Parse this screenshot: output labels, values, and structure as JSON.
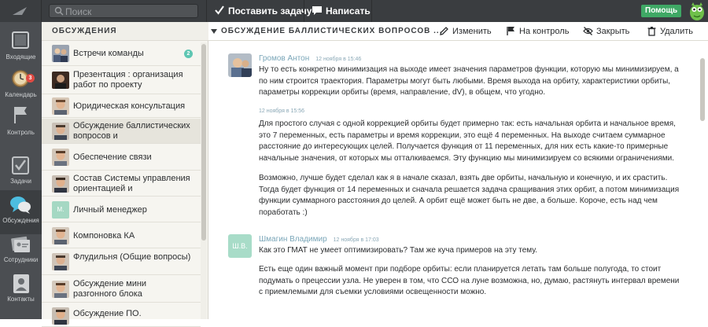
{
  "topbar": {
    "search_placeholder": "Поиск",
    "new_task_label": "Поставить задачу",
    "write_label": "Написать",
    "help_label": "Помощь"
  },
  "leftnav": {
    "items": [
      {
        "label": "Входящие",
        "icon": "inbox-icon"
      },
      {
        "label": "Календарь",
        "icon": "clock-icon",
        "badge": "3"
      },
      {
        "label": "Контроль",
        "icon": "flag-icon"
      },
      {
        "label": "Задачи",
        "icon": "checkbox-icon"
      },
      {
        "label": "Обсуждения",
        "icon": "chat-bubbles-icon",
        "active": true
      },
      {
        "label": "Сотрудники",
        "icon": "contacts-cards-icon"
      },
      {
        "label": "Контакты",
        "icon": "person-icon"
      }
    ]
  },
  "list": {
    "header": "ОБСУЖДЕНИЯ",
    "items": [
      {
        "title": "Встречи команды",
        "count": "2"
      },
      {
        "title": "Презентация : организация работ по проекту"
      },
      {
        "title": "Юридическая консультация"
      },
      {
        "title": "Обсуждение баллистических вопросов и",
        "active": true
      },
      {
        "title": "Обеспечение связи"
      },
      {
        "title": "Состав Системы управления ориентацией и"
      },
      {
        "title": "Личный менеджер",
        "initials": "М."
      },
      {
        "title": "Компоновка КА"
      },
      {
        "title": "Флудильня (Общие вопросы)"
      },
      {
        "title": "Обсуждение мини разгонного блока"
      },
      {
        "title": "Обсуждение ПО."
      }
    ]
  },
  "main": {
    "title": "ОБСУЖДЕНИЕ БАЛЛИСТИЧЕСКИХ ВОПРОСОВ ...",
    "actions": {
      "edit": "Изменить",
      "control": "На контроль",
      "close": "Закрыть",
      "delete": "Удалить"
    },
    "messages": [
      {
        "author": "Громов Антон",
        "time": "12 ноября в 15:46",
        "text": "Ну то есть конкретно минимизация на выходе имеет значения параметров функции, которую мы минимизируем, а по ним строится траектория. Параметры могут быть любыми. Время выхода на орбиту, характеристики орбиты, параметры коррекции орбиты (время, направление, dV), в общем, что угодно."
      },
      {
        "time": "12 ноября в 15:56",
        "text": "Для простого случая с одной коррекцией орбиты будет примерно так: есть начальная орбита и начальное время, это 7 переменных, есть параметры и время коррекции, это ещё 4 переменных. На выходе считаем суммарное расстояние до интересующих целей. Получается функция от 11 переменных, для них есть какие-то примерные начальные значения, от которых мы отталкиваемся. Эту функцию мы минимизируем со всякими ограничениями.",
        "text2": "Возможно, лучше будет сделал как я в начале сказал, взять две орбиты, начальную и конечную, и их срастить. Тогда будет функция от 14 переменных и сначала решается задача сращивания этих орбит, а потом минимизация функции суммарного расстояния до целей. А орбит ещё может быть не две, а больше. Короче, есть над чем поработать :)"
      },
      {
        "author": "Шмагин Владимир",
        "initials": "Ш.В.",
        "time": "12 ноября в 17:03",
        "text": "Как это ГМАТ не умеет оптимизировать? Там же куча примеров на эту тему.",
        "text2": "Есть еще один важный момент при подборе орбиты: если планируется летать там больше полугода, то стоит подумать о прецессии узла. Не уверен в том, что ССО на луне возможна, но, думаю, растянуть интервал времени с приемлемыми для съемки условиями освещенности можно."
      }
    ]
  },
  "colors": {
    "topbar": "#3a3d40",
    "sidebar": "#4b4e52",
    "accent_green": "#3fa865",
    "author": "#7aa6b8",
    "count_badge": "#5ec6b2"
  }
}
